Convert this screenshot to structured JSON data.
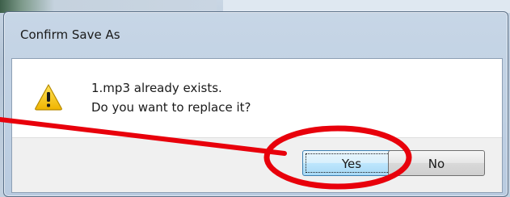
{
  "dialog": {
    "title": "Confirm Save As",
    "message_line1": "1.mp3 already exists.",
    "message_line2": "Do you want to replace it?",
    "icon": "warning-icon"
  },
  "buttons": {
    "yes_label": "Yes",
    "no_label": "No"
  },
  "annotation": {
    "color": "#e8000b",
    "target": "Yes"
  },
  "colors": {
    "frame": "#b9cbe0",
    "button_bar": "#f0f0f0",
    "default_button": "#bee6fd",
    "warning": "#f5c400"
  }
}
